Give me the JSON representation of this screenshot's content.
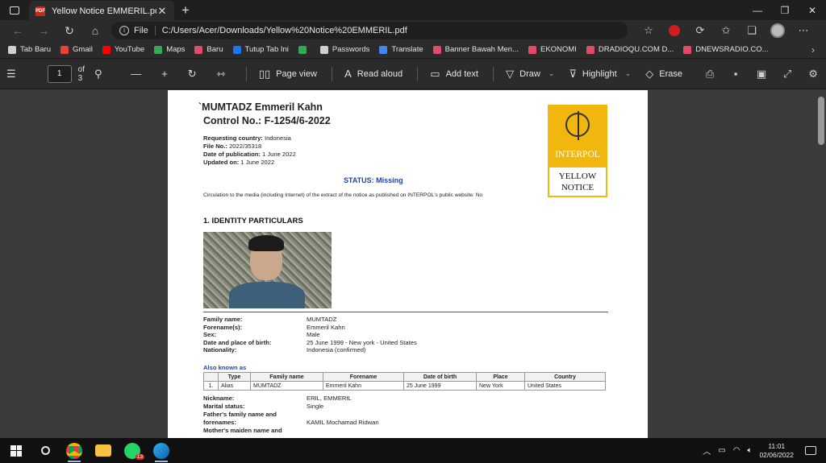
{
  "browser": {
    "tab_title": "Yellow Notice EMMERIL.pdf",
    "tab_close": "✕",
    "new_tab": "+",
    "url_scheme": "File",
    "url": "C:/Users/Acer/Downloads/Yellow%20Notice%20EMMERIL.pdf"
  },
  "bookmarks": [
    {
      "label": "Tab Baru",
      "color": "#cfcfcf"
    },
    {
      "label": "Gmail",
      "color": "#ea4335"
    },
    {
      "label": "YouTube",
      "color": "#ff0000"
    },
    {
      "label": "Maps",
      "color": "#34a853"
    },
    {
      "label": "Baru",
      "color": "#e04b6a"
    },
    {
      "label": "Tutup Tab Ini",
      "color": "#1877f2"
    },
    {
      "label": "",
      "color": "#34a853"
    },
    {
      "label": "Passwords",
      "color": "#cfcfcf"
    },
    {
      "label": "Translate",
      "color": "#4285f4"
    },
    {
      "label": "Banner Bawah Men...",
      "color": "#e04b6a"
    },
    {
      "label": "EKONOMI",
      "color": "#e04b6a"
    },
    {
      "label": "DRADIOQU.COM D...",
      "color": "#e04b6a"
    },
    {
      "label": "DNEWSRADIO.CO...",
      "color": "#e04b6a"
    }
  ],
  "pdf_toolbar": {
    "page_current": "1",
    "page_of": "of 3",
    "page_view": "Page view",
    "read_aloud": "Read aloud",
    "add_text": "Add text",
    "draw": "Draw",
    "highlight": "Highlight",
    "erase": "Erase"
  },
  "document": {
    "name": "`MUMTADZ Emmeril Kahn",
    "control": "Control No.: F-1254/6-2022",
    "requesting_country_label": "Requesting country:",
    "requesting_country": "Indonesia",
    "file_no_label": "File No.:",
    "file_no": "2022/35318",
    "date_pub_label": "Date of publication:",
    "date_pub": "1 June 2022",
    "updated_label": "Updated on:",
    "updated": "1 June 2022",
    "status": "STATUS: Missing",
    "circulation": "Circulation to the media (including Internet) of the extract of the notice as published on INTERPOL's public website: No",
    "section_title": "1. IDENTITY PARTICULARS",
    "badge_org": "INTERPOL",
    "badge_line1": "YELLOW",
    "badge_line2": "NOTICE",
    "fields": [
      {
        "label": "Family name:",
        "value": "MUMTADZ"
      },
      {
        "label": "Forename(s):",
        "value": "Emmeril Kahn"
      },
      {
        "label": "Sex:",
        "value": "Male"
      },
      {
        "label": "Date and place of birth:",
        "value": "25 June 1999 - New york - United States"
      },
      {
        "label": "Nationality:",
        "value": "Indonesia (confirmed)"
      }
    ],
    "aka_title": "Also known as",
    "aka_headers": [
      "",
      "Type",
      "Family name",
      "Forename",
      "Date of birth",
      "Place",
      "Country"
    ],
    "aka_rows": [
      [
        "1.",
        "Alias",
        "MUMTADZ",
        "Emmeril Kahn",
        "25 June 1999",
        "New York",
        "United States"
      ]
    ],
    "fields2": [
      {
        "label": "Nickname:",
        "value": "ERIL, EMMERIL"
      },
      {
        "label": "Marital status:",
        "value": "Single"
      },
      {
        "label": "Father's family name and",
        "value": ""
      },
      {
        "label": "forenames:",
        "value": "KAMIL Mochamad Ridwan"
      },
      {
        "label": "Mother's maiden name and",
        "value": ""
      }
    ]
  },
  "taskbar": {
    "whatsapp_badge": "13",
    "time": "11:01",
    "date": "02/06/2022"
  }
}
